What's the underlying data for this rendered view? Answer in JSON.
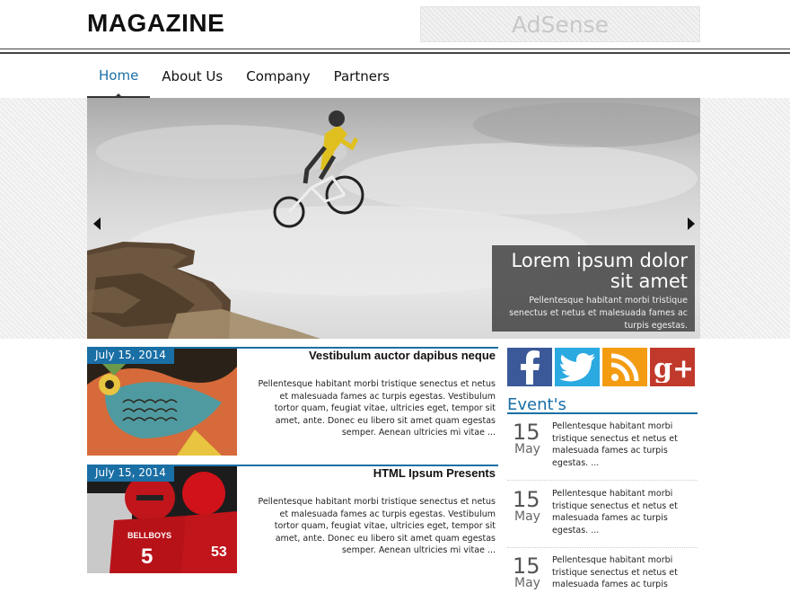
{
  "header": {
    "logo": "MAGAZINE",
    "ad_label": "AdSense"
  },
  "nav": {
    "items": [
      {
        "label": "Home",
        "active": true
      },
      {
        "label": "About Us",
        "active": false
      },
      {
        "label": "Company",
        "active": false
      },
      {
        "label": "Partners",
        "active": false
      }
    ]
  },
  "slider": {
    "caption_title": "Lorem ipsum dolor sit amet",
    "caption_text": "Pellentesque habitant morbi tristique senectus et netus et malesuada fames ac turpis egestas.",
    "prev_icon": "triangle-left",
    "next_icon": "triangle-right"
  },
  "articles": [
    {
      "date": "July 15, 2014",
      "title": "Vestibulum auctor dapibus neque",
      "body": "Pellentesque habitant morbi tristique senectus et netus et malesuada fames ac turpis egestas. Vestibulum tortor quam, feugiat vitae, ultricies eget, tempor sit amet, ante. Donec eu libero sit amet quam egestas semper. Aenean ultricies mi vitae ..."
    },
    {
      "date": "July 15, 2014",
      "title": "HTML Ipsum Presents",
      "body": "Pellentesque habitant morbi tristique senectus et netus et malesuada fames ac turpis egestas. Vestibulum tortor quam, feugiat vitae, ultricies eget, tempor sit amet, ante. Donec eu libero sit amet quam egestas semper. Aenean ultricies mi vitae ..."
    }
  ],
  "social": {
    "icons": [
      "facebook-icon",
      "twitter-icon",
      "rss-icon",
      "google-plus-icon"
    ],
    "colors": {
      "facebook": "#3b5998",
      "twitter": "#2ba9e1",
      "rss": "#f39c12",
      "google_plus": "#c0392b"
    }
  },
  "events": {
    "title": "Event's",
    "items": [
      {
        "day": "15",
        "month": "May",
        "text": "Pellentesque habitant morbi tristique senectus et netus et malesuada fames ac turpis egestas. ..."
      },
      {
        "day": "15",
        "month": "May",
        "text": "Pellentesque habitant morbi tristique senectus et netus et malesuada fames ac turpis egestas. ..."
      },
      {
        "day": "15",
        "month": "May",
        "text": "Pellentesque habitant morbi tristique senectus et netus et malesuada fames ac turpis egestas."
      }
    ]
  },
  "colors": {
    "accent": "#1a6fa5"
  }
}
